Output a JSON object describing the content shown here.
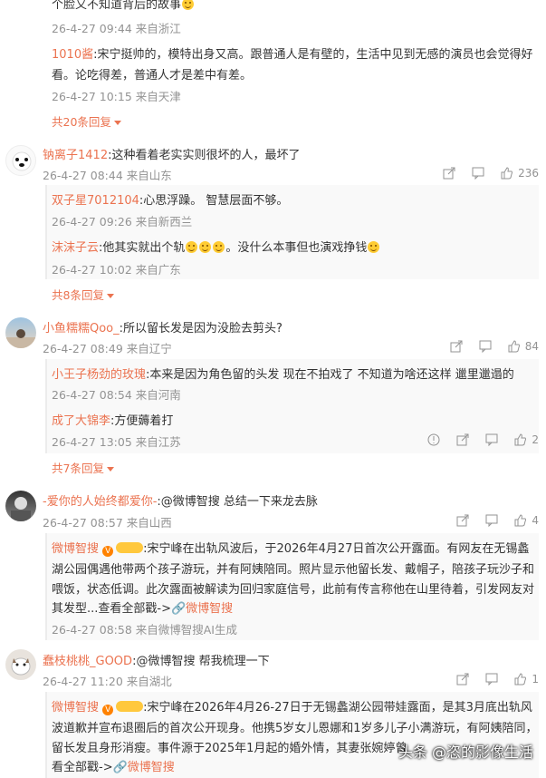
{
  "top_partial": {
    "text": "个脸又不知道背后的故事",
    "meta": "26-4-27 09:44 来自浙江"
  },
  "thread1_replies": [
    {
      "nick": "1010酱",
      "text": ":宋宁挺帅的，模特出身又高。跟普通人是有壁的，生活中见到无感的演员也会觉得好",
      "text2": "看。论吃得差，普通人才是差中有差。",
      "meta": "26-4-27 10:15 来自天津"
    }
  ],
  "thread1_more": "共20条回复",
  "comments": [
    {
      "nick": "钠离子1412",
      "text": ":这种看着老实实则很坏的人，最坏了",
      "meta": "26-4-27 08:44 来自山东",
      "likes": "236",
      "replies": [
        {
          "nick": "双子星7012104",
          "text": ":心思浮躁。 智慧层面不够。",
          "meta": "26-4-27 09:26 来自新西兰"
        },
        {
          "nick": "沫沫子云",
          "text": ":他其实就出个轨",
          "text_tail": "。没什么本事但也演戏挣钱",
          "meta": "26-4-27 10:02 来自广东"
        }
      ],
      "more": "共8条回复"
    },
    {
      "nick": "小鱼糯糯Qoo_",
      "text": ":所以留长发是因为没脸去剪头?",
      "meta": "26-4-27 08:49 来自辽宁",
      "likes": "84",
      "replies": [
        {
          "nick": "小王子杨劲的玫瑰",
          "text": ":本来是因为角色留的头发 现在不拍戏了 不知道为啥还这样 邋里邋遢的",
          "meta": "26-4-27 08:54 来自河南"
        },
        {
          "nick": "成了大锦李",
          "text": ":方便薅着打",
          "meta": "26-4-27 13:05 来自江苏",
          "likes": "2"
        }
      ],
      "more": "共7条回复"
    },
    {
      "nick": "-爱你的人始终都爱你-",
      "text": ":@微博智搜 总结一下来龙去脉",
      "meta": "26-4-27 08:57 来自山西",
      "likes": "4",
      "ai_reply": {
        "nick": "微博智搜",
        "line1": ":宋宁峰在出轨风波后，于2026年4月27日首次公开露面。有网友在无锡蠡",
        "line2": "湖公园偶遇他带两个孩子游玩，并有阿姨陪同。照片显示他留长发、戴帽子，陪孩子玩沙子和",
        "line3": "喂饭，状态低调。此次露面被解读为回归家庭信号，此前有传言称他在山里待着，引发网友对",
        "line4": "其发型...查看全部戳->",
        "link": "微博智搜",
        "meta": "26-4-27 08:58 来自微博智搜AI生成"
      }
    },
    {
      "nick": "蠢枝桃桃_GOOD",
      "text": ":@微博智搜 帮我梳理一下",
      "meta": "26-4-27 11:20 来自湖北",
      "likes": "1",
      "ai_reply": {
        "nick": "微博智搜",
        "line1": ":宋宁峰在2026年4月26-27日于无锡蠡湖公园带娃露面，是其3月底出轨风",
        "line2": "波道歉并宣布退圈后的首次公开现身。他携5岁女儿恩娜和1岁多儿子小满游玩，有阿姨陪同，",
        "line3": "留长发且身形消瘦。事件源于2025年1月起的婚外情，其妻张婉婷曾",
        "line4": "看全部戳->",
        "link": "微博智搜"
      }
    }
  ],
  "watermark": "头条 @恣的影像生活",
  "colors": {
    "accent": "#eb7350",
    "meta": "#939393",
    "reply_bg": "#f9f9f9"
  }
}
